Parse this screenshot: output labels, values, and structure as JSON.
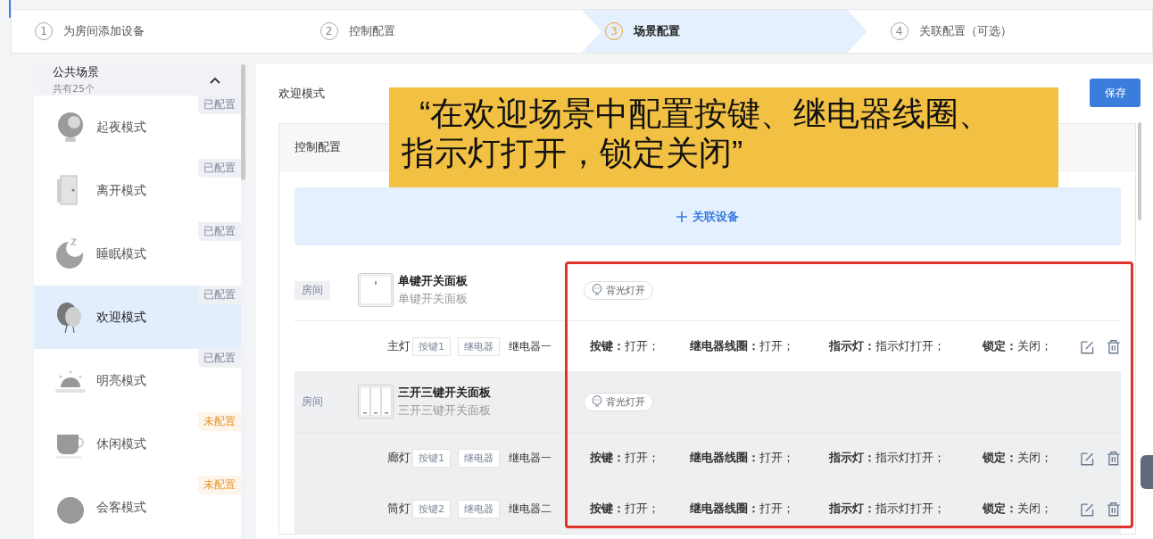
{
  "steps": [
    {
      "number": "1",
      "label": "为房间添加设备",
      "selected": false
    },
    {
      "number": "2",
      "label": "控制配置",
      "selected": false
    },
    {
      "number": "3",
      "label": "场景配置",
      "selected": true
    },
    {
      "number": "4",
      "label": "关联配置（可选）",
      "selected": false
    }
  ],
  "sidebar": {
    "title": "公共场景",
    "count": "共有25个",
    "expanded": true,
    "items": [
      {
        "name": "起夜模式",
        "status": "已配置",
        "configured": true,
        "selected": false
      },
      {
        "name": "离开模式",
        "status": "已配置",
        "configured": true,
        "selected": false
      },
      {
        "name": "睡眠模式",
        "status": "已配置",
        "configured": true,
        "selected": false
      },
      {
        "name": "欢迎模式",
        "status": "已配置",
        "configured": true,
        "selected": true
      },
      {
        "name": "明亮模式",
        "status": "已配置",
        "configured": true,
        "selected": false
      },
      {
        "name": "休闲模式",
        "status": "未配置",
        "configured": false,
        "selected": false
      },
      {
        "name": "会客模式",
        "status": "未配置",
        "configured": false,
        "selected": false
      }
    ]
  },
  "main": {
    "title": "欢迎模式",
    "save_button": "保存",
    "section_title": "控制配置",
    "add_device": "关联设备",
    "callout": "“在欢迎场景中配置按键、继电器线圈、指示灯打开，锁定关闭”",
    "devices": [
      {
        "room": "房间",
        "name": "单键开关面板",
        "model": "单键开关面板",
        "kind": "single",
        "backlight": "背光灯开",
        "highlighted": false,
        "channels": [
          {
            "light": "主灯",
            "key": "按键1",
            "relay_tag": "继电器",
            "relay": "继电器一",
            "settings": [
              "**按键：**打开；",
              "**继电器线圈：**打开；",
              "**指示灯：**指示灯打开；",
              "**锁定：**关闭；"
            ]
          }
        ]
      },
      {
        "room": "房间",
        "name": "三开三键开关面板",
        "model": "三开三键开关面板",
        "kind": "triple",
        "backlight": "背光灯开",
        "highlighted": true,
        "channels": [
          {
            "light": "廊灯",
            "key": "按键1",
            "relay_tag": "继电器",
            "relay": "继电器一",
            "settings": [
              "**按键：**打开；",
              "**继电器线圈：**打开；",
              "**指示灯：**指示灯打开；",
              "**锁定：**关闭；"
            ]
          },
          {
            "light": "筒灯",
            "key": "按键2",
            "relay_tag": "继电器",
            "relay": "继电器二",
            "settings": [
              "**按键：**打开；",
              "**继电器线圈：**打开；",
              "**指示灯：**指示灯打开；",
              "**锁定：**关闭；"
            ]
          }
        ]
      }
    ]
  }
}
